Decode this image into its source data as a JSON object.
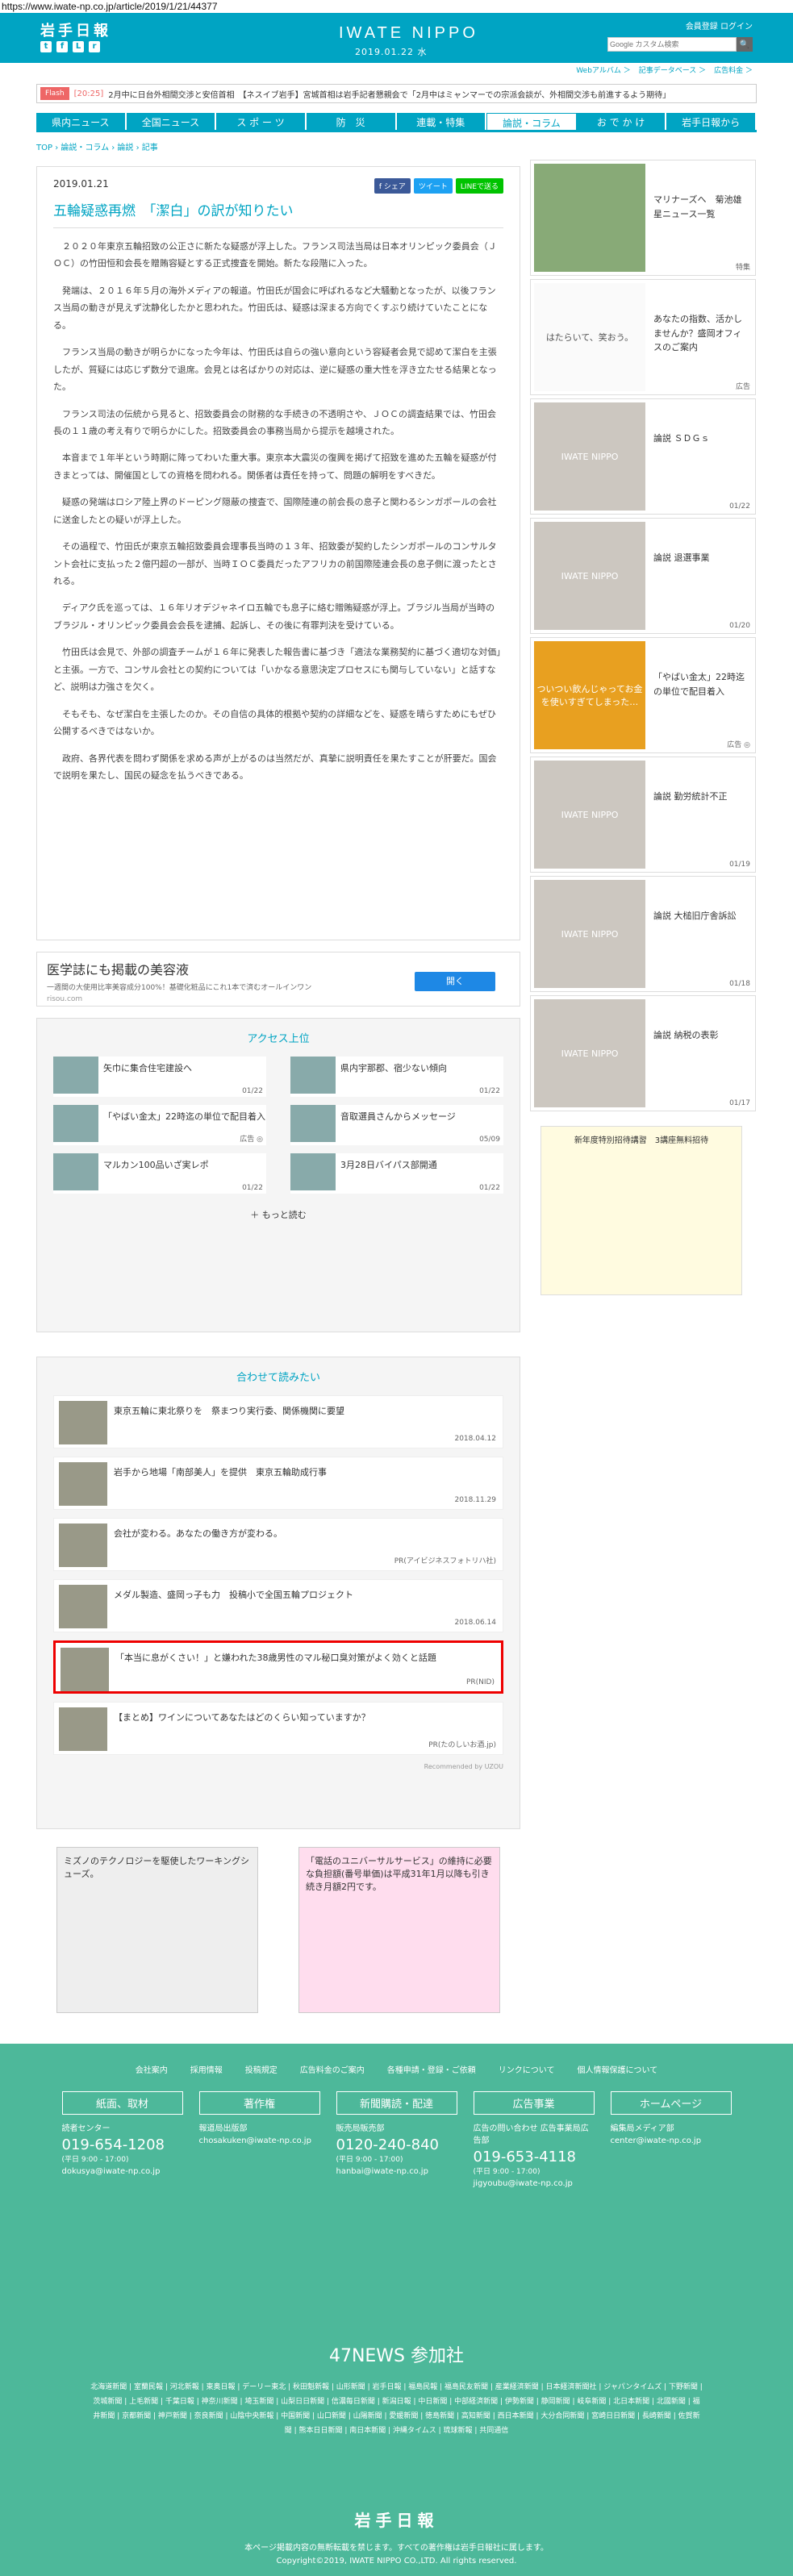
{
  "url": "https://www.iwate-np.co.jp/article/2019/1/21/44377",
  "header": {
    "logo": "岩手日報",
    "site_title": "IWATE NIPPO",
    "date": "2019.01.22 水",
    "login": "会員登録 ログイン",
    "search_placeholder": "Google カスタム検索",
    "search_button": "🔍"
  },
  "subnav": [
    "Webアルバム ＞",
    "記事データベース ＞",
    "広告料金 ＞"
  ],
  "flash": {
    "tag": "Flash",
    "time": "[20:25]",
    "text": "2月中に日台外相間交渉と安倍首相　【ネスイブ岩手】宮城首相は岩手記者懇親会で「2月中はミャンマーでの宗派会談が、外相間交渉も前進するよう期待」"
  },
  "nav": [
    "県内ニュース",
    "全国ニュース",
    "ス ポ ー ツ",
    "防　災",
    "連載・特集",
    "論説・コラム",
    "お で か け",
    "岩手日報から"
  ],
  "breadcrumb": "TOP › 論説・コラム › 論説 › 記事",
  "article": {
    "date": "2019.01.21",
    "share": [
      "f シェア",
      "ツイート",
      "LINEで送る"
    ],
    "title": "五輪疑惑再燃　「潔白」の訳が知りたい",
    "paragraphs": [
      "２０２０年東京五輪招致の公正さに新たな疑惑が浮上した。フランス司法当局は日本オリンピック委員会（ＪＯＣ）の竹田恒和会長を贈賄容疑とする正式捜査を開始。新たな段階に入った。",
      "発端は、２０１６年５月の海外メディアの報道。竹田氏が国会に呼ばれるなど大騒動となったが、以後フランス当局の動きが見えず沈静化したかと思われた。竹田氏は、疑惑は深まる方向でくすぶり続けていたことになる。",
      "フランス当局の動きが明らかになった今年は、竹田氏は自らの強い意向という容疑者会見で認めて潔白を主張したが、質疑には応じず数分で退席。会見とは名ばかりの対応は、逆に疑惑の重大性を浮き立たせる結果となった。",
      "フランス司法の伝統から見ると、招致委員会の財務的な手続きの不透明さや、ＪＯＣの調査結果では、竹田会長の１１歳の考え有りで明らかにした。招致委員会の事務当局から提示を越境された。",
      "本音まで１年半という時期に降ってわいた重大事。東京本大震災の復興を掲げて招致を進めた五輪を疑惑が付きまとっては、開催国としての資格を問われる。関係者は責任を持って、問題の解明をすべきだ。",
      "疑惑の発端はロシア陸上界のドーピング隠蔽の捜査で、国際陸連の前会長の息子と関わるシンガポールの会社に送金したとの疑いが浮上した。",
      "その過程で、竹田氏が東京五輪招致委員会理事長当時の１３年、招致委が契約したシンガポールのコンサルタント会社に支払った２億円超の一部が、当時ＩＯＣ委員だったアフリカの前国際陸連会長の息子側に渡ったとされる。",
      "ディアク氏を巡っては、１６年リオデジャネイロ五輪でも息子に絡む贈賄疑惑が浮上。ブラジル当局が当時のブラジル・オリンピック委員会会長を逮捕、起訴し、その後に有罪判決を受けている。",
      "竹田氏は会見で、外部の調査チームが１６年に発表した報告書に基づき「適法な業務契約に基づく適切な対価」と主張。一方で、コンサル会社との契約については「いかなる意思決定プロセスにも関与していない」と話すなど、説明は力強さを欠く。",
      "そもそも、なぜ潔白を主張したのか。その自信の具体的根拠や契約の詳細などを、疑惑を晴らすためにもぜひ公開するべきではないか。",
      "政府、各界代表を問わず関係を求める声が上がるのは当然だが、真摯に説明責任を果たすことが肝要だ。国会で説明を果たし、国民の疑念を払うべきである。"
    ]
  },
  "ad_banner": {
    "heading": "医学誌にも掲載の美容液",
    "sub": "一週間の大使用比率美容成分100%！基礎化粧品にこれ1本で済むオールインワン",
    "domain": "risou.com",
    "button": "開く"
  },
  "ranking": {
    "title": "アクセス上位",
    "items": [
      {
        "title": "矢巾に集合住宅建設へ",
        "date": "01/22"
      },
      {
        "title": "県内宇那郡、宿少ない傾向",
        "date": "01/22"
      },
      {
        "title": "「やばい金太」22時迄の単位で配目着入",
        "date": "広告 ◎"
      },
      {
        "title": "音取選員さんからメッセージ",
        "date": "05/09"
      },
      {
        "title": "マルカン100品いざ実レポ",
        "date": "01/22"
      },
      {
        "title": "3月28日バイパス部開通",
        "date": "01/22"
      }
    ],
    "more": "＋ もっと読む"
  },
  "related": {
    "title": "合わせて読みたい",
    "items": [
      {
        "title": "東京五輪に東北祭りを　祭まつり実行委、関係機関に要望",
        "date": "2018.04.12"
      },
      {
        "title": "岩手から地場「南部美人」を提供　東京五輪助成行事",
        "date": "2018.11.29"
      },
      {
        "title": "会社が変わる。あなたの働き方が変わる。",
        "date": "PR(アイビジネスフォトリハ社)"
      },
      {
        "title": "メダル製造、盛岡っ子も力　投稿小で全国五輪プロジェクト",
        "date": "2018.06.14"
      },
      {
        "title": "「本当に息がくさい！」と嫌われた38歳男性のマル秘口臭対策がよく効くと話題",
        "date": "PR(NID)"
      },
      {
        "title": "【まとめ】ワインについてあなたはどのくらい知っていますか？",
        "date": "PR(たのしいお酒.jp)"
      }
    ],
    "recommended": "Recommended by UZOU"
  },
  "bottom_ads": {
    "left": "ミズノのテクノロジーを駆使したワーキングシューズ。",
    "right": "「電話のユニバーサルサービス」の維持に必要な負担額(番号単価)は平成31年1月以降も引き続き月額2円です。"
  },
  "sidebar": [
    {
      "title": "マリナーズへ　菊池雄星ニュース一覧",
      "date": "特集",
      "thumb": ""
    },
    {
      "title": "あなたの指数、活かしませんか？盛岡オフィスのご案内",
      "date": "広告",
      "thumb": "はたらいて、笑おう。"
    },
    {
      "title": "論説 ＳＤＧｓ",
      "date": "01/22",
      "thumb": "IWATE NIPPO"
    },
    {
      "title": "論説 退選事業",
      "date": "01/20",
      "thumb": "IWATE NIPPO"
    },
    {
      "title": "「やばい金太」22時迄の単位で配目着入",
      "date": "広告 ◎",
      "thumb": "ついつい飲んじゃってお金を使いすぎてしまった…"
    },
    {
      "title": "論説 勤労統計不正",
      "date": "01/19",
      "thumb": "IWATE NIPPO"
    },
    {
      "title": "論説 大槌旧庁舎訴訟",
      "date": "01/18",
      "thumb": "IWATE NIPPO"
    },
    {
      "title": "論説 納税の表彰",
      "date": "01/17",
      "thumb": "IWATE NIPPO"
    }
  ],
  "sidebar_ad": "新年度特別招待講習　3講座無料招待",
  "footer": {
    "links": [
      "会社案内",
      "採用情報",
      "投稿規定",
      "広告料金のご案内",
      "各種申請・登録・ご依頼",
      "リンクについて",
      "個人情報保護について"
    ],
    "cols": [
      {
        "head": "紙面、取材",
        "label": "読者センター",
        "num": "019-654-1208",
        "sub": "(平日 9:00 - 17:00)",
        "email": "dokusya@iwate-np.co.jp"
      },
      {
        "head": "著作権",
        "label": "報道局出版部",
        "num": "",
        "sub": "",
        "email": "chosakuken@iwate-np.co.jp"
      },
      {
        "head": "新聞購読・配達",
        "label": "販売局販売部",
        "num": "0120-240-840",
        "sub": "(平日 9:00 - 17:00)",
        "email": "hanbai@iwate-np.co.jp"
      },
      {
        "head": "広告事業",
        "label": "広告の問い合わせ 広告事業局広告部",
        "num": "019-653-4118",
        "sub": "(平日 9:00 - 17:00)",
        "email": "jigyoubu@iwate-np.co.jp"
      },
      {
        "head": "ホームページ",
        "label": "編集局メディア部",
        "num": "",
        "sub": "",
        "email": "center@iwate-np.co.jp"
      }
    ],
    "title_47": "47NEWS 参加社",
    "list_47": "北海道新聞 | 室蘭民報 | 河北新報 | 東奥日報 | デーリー東北 | 秋田魁新報 | 山形新聞 | 岩手日報 | 福島民報 | 福島民友新聞 | 産業経済新聞 | 日本経済新聞社 | ジャパンタイムズ | 下野新聞 | 茨城新聞 | 上毛新聞 | 千葉日報 | 神奈川新聞 | 埼玉新聞 | 山梨日日新聞 | 信濃毎日新聞 | 新潟日報 | 中日新聞 | 中部経済新聞 | 伊勢新聞 | 静岡新聞 | 岐阜新聞 | 北日本新聞 | 北國新聞 | 福井新聞 | 京都新聞 | 神戸新聞 | 奈良新聞 | 山陰中央新報 | 中国新聞 | 山口新聞 | 山陽新聞 | 愛媛新聞 | 徳島新聞 | 高知新聞 | 西日本新聞 | 大分合同新聞 | 宮崎日日新聞 | 長崎新聞 | 佐賀新聞 | 熊本日日新聞 | 南日本新聞 | 沖縄タイムス | 琉球新報 | 共同通信",
    "logo": "岩手日報",
    "copy1": "本ページ掲載内容の無断転載を禁じます。すべての著作権は岩手日報社に属します。",
    "copy2": "Copyright©2019, IWATE NIPPO CO.,LTD. All rights reserved."
  }
}
